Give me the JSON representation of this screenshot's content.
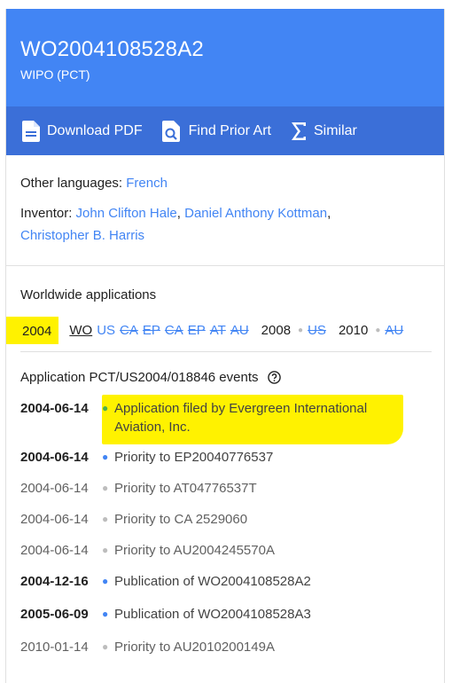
{
  "header": {
    "publication_number": "WO2004108528A2",
    "office": "WIPO (PCT)",
    "background_color": "#4285f4"
  },
  "toolbar": {
    "download_label": "Download PDF",
    "prior_art_label": "Find Prior Art",
    "similar_label": "Similar",
    "background_color": "#3b6fd8"
  },
  "info": {
    "other_languages_label": "Other languages:",
    "other_languages_value": "French",
    "inventor_label": "Inventor:",
    "inventor_1": "John Clifton Hale",
    "inventor_2": "Daniel Anthony Kottman",
    "inventor_3": "Christopher B. Harris"
  },
  "worldwide": {
    "title": "Worldwide applications",
    "year_2004": "2004",
    "countries_2004": [
      {
        "code": "WO",
        "state": "active"
      },
      {
        "code": "US",
        "state": "normal"
      },
      {
        "code": "CA",
        "state": "strike"
      },
      {
        "code": "EP",
        "state": "strike"
      },
      {
        "code": "CA",
        "state": "strike"
      },
      {
        "code": "EP",
        "state": "strike"
      },
      {
        "code": "AT",
        "state": "strike"
      },
      {
        "code": "AU",
        "state": "strike"
      }
    ],
    "year_2008": "2008",
    "country_2008": "US",
    "year_2010": "2010",
    "country_2010": "AU"
  },
  "events": {
    "title": "Application PCT/US2004/018846 events",
    "help_icon": "help-circle-icon",
    "items": [
      {
        "date": "2004-06-14",
        "text": "Application filed by Evergreen International Aviation, Inc.",
        "style": "bold",
        "bullet": "#4caf50"
      },
      {
        "date": "2004-06-14",
        "text": "Priority to EP20040776537",
        "style": "bold",
        "bullet": "#4285f4"
      },
      {
        "date": "2004-06-14",
        "text": "Priority to AT04776537T",
        "style": "grey",
        "bullet": "#bdbdbd"
      },
      {
        "date": "2004-06-14",
        "text": "Priority to CA 2529060",
        "style": "grey",
        "bullet": "#bdbdbd"
      },
      {
        "date": "2004-06-14",
        "text": "Priority to AU2004245570A",
        "style": "grey",
        "bullet": "#bdbdbd"
      },
      {
        "date": "2004-12-16",
        "text": "Publication of WO2004108528A2",
        "style": "bold",
        "bullet": "#4285f4"
      },
      {
        "date": "2005-06-09",
        "text": "Publication of WO2004108528A3",
        "style": "bold",
        "bullet": "#4285f4"
      },
      {
        "date": "2010-01-14",
        "text": "Priority to AU2010200149A",
        "style": "grey",
        "bullet": "#bdbdbd"
      }
    ]
  },
  "highlight_color": "#fff200"
}
